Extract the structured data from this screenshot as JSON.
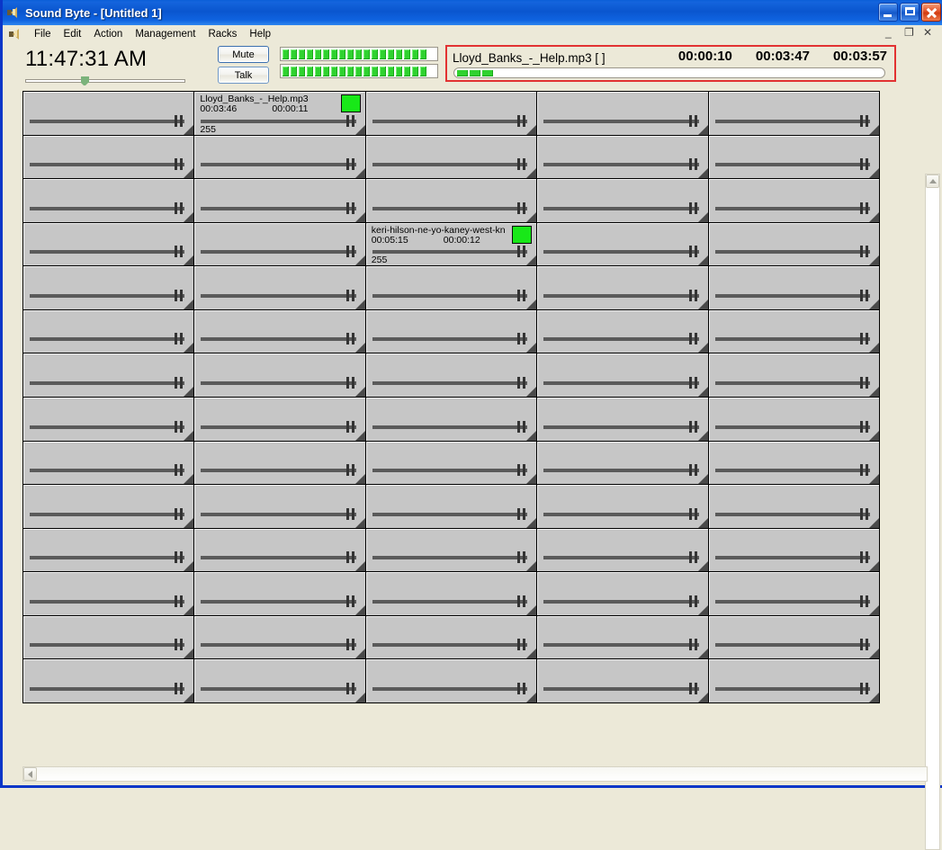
{
  "window": {
    "title": "Sound Byte - [Untitled 1]",
    "icon": "speaker-icon",
    "minimize_label": "_",
    "maximize_label": "□",
    "close_label": "✕",
    "mdi_minimize_label": "_",
    "mdi_restore_label": "❐",
    "mdi_close_label": "✕"
  },
  "menu": {
    "icon": "speaker-icon",
    "items": [
      "File",
      "Edit",
      "Action",
      "Management",
      "Racks",
      "Help"
    ]
  },
  "toolbar": {
    "clock": "11:47:31 AM",
    "slider_value": 37,
    "mute_label": "Mute",
    "talk_label": "Talk",
    "meters": [
      {
        "name": "left-level-meter",
        "segments": 19,
        "lit": 18
      },
      {
        "name": "right-level-meter",
        "segments": 19,
        "lit": 18
      }
    ]
  },
  "now_playing": {
    "title": "Lloyd_Banks_-_Help.mp3 [ ]",
    "elapsed": "00:00:10",
    "remaining": "00:03:47",
    "total": "00:03:57",
    "progress_segments": 3,
    "border_color": "#e23232"
  },
  "grid": {
    "columns": 5,
    "rows": 14,
    "cells": [
      {
        "index": 1,
        "loaded": false
      },
      {
        "index": 2,
        "loaded": true,
        "name": "Lloyd_Banks_-_Help.mp3",
        "time_total": "00:03:46",
        "time_elapsed": "00:00:11",
        "number": "255",
        "led_color": "#18e818"
      },
      {
        "index": 3,
        "loaded": false
      },
      {
        "index": 4,
        "loaded": false
      },
      {
        "index": 5,
        "loaded": false
      },
      {
        "index": 6,
        "loaded": false
      },
      {
        "index": 7,
        "loaded": false
      },
      {
        "index": 8,
        "loaded": false
      },
      {
        "index": 9,
        "loaded": false
      },
      {
        "index": 10,
        "loaded": false
      },
      {
        "index": 11,
        "loaded": false
      },
      {
        "index": 12,
        "loaded": false
      },
      {
        "index": 13,
        "loaded": false
      },
      {
        "index": 14,
        "loaded": false
      },
      {
        "index": 15,
        "loaded": false
      },
      {
        "index": 16,
        "loaded": false
      },
      {
        "index": 17,
        "loaded": false
      },
      {
        "index": 18,
        "loaded": true,
        "name": "keri-hilson-ne-yo-kaney-west-kn",
        "time_total": "00:05:15",
        "time_elapsed": "00:00:12",
        "number": "255",
        "led_color": "#18e818"
      },
      {
        "index": 19,
        "loaded": false
      },
      {
        "index": 20,
        "loaded": false
      }
    ]
  },
  "scrollbars": {
    "vertical_up_icon": "chevron-up-icon",
    "horizontal_left_icon": "chevron-left-icon"
  }
}
